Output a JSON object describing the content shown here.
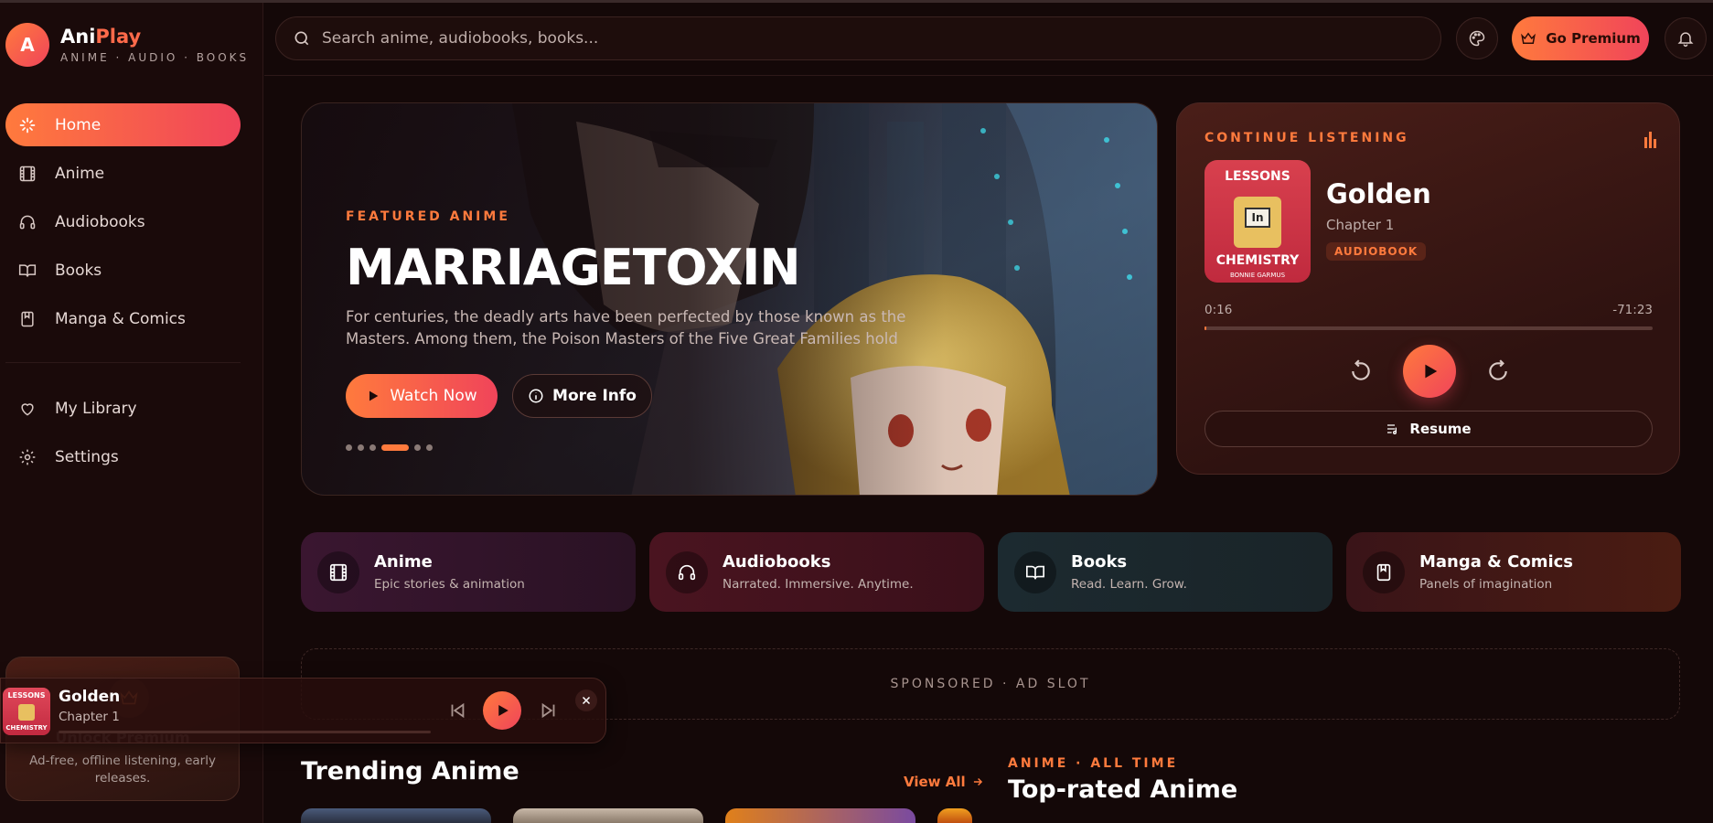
{
  "brand": {
    "logo_letter": "A",
    "name_part1": "Ani",
    "name_part2": "Play",
    "tagline": "ANIME · AUDIO · BOOKS"
  },
  "colors": {
    "accent": "#ff7a3d",
    "accent2": "#f0445a",
    "background": "#140808"
  },
  "nav": {
    "items": [
      {
        "label": "Home",
        "icon": "sparkle-icon",
        "active": true
      },
      {
        "label": "Anime",
        "icon": "film-icon"
      },
      {
        "label": "Audiobooks",
        "icon": "headphones-icon"
      },
      {
        "label": "Books",
        "icon": "open-book-icon"
      },
      {
        "label": "Manga & Comics",
        "icon": "bookmark-book-icon"
      }
    ],
    "secondary": [
      {
        "label": "My Library",
        "icon": "heart-icon"
      },
      {
        "label": "Settings",
        "icon": "gear-icon"
      }
    ]
  },
  "promo": {
    "title": "Unlock Premium",
    "text": "Ad-free, offline listening, early releases."
  },
  "header": {
    "search_placeholder": "Search anime, audiobooks, books...",
    "premium_label": "Go Premium"
  },
  "hero": {
    "eyebrow": "FEATURED ANIME",
    "title": "MARRIAGETOXIN",
    "description": "For centuries, the deadly arts have been perfected by those known as the Masters. Among them, the Poison Masters of the Five Great Families hold t...",
    "watch_label": "Watch Now",
    "info_label": "More Info",
    "slides": 6,
    "active_slide": 3
  },
  "continue": {
    "eyebrow": "CONTINUE LISTENING",
    "cover_line1": "LESSONS",
    "cover_line2": "In",
    "cover_line3": "CHEMISTRY",
    "cover_author": "BONNIE GARMUS",
    "title": "Golden",
    "chapter": "Chapter 1",
    "badge": "AUDIOBOOK",
    "elapsed": "0:16",
    "remaining": "-71:23",
    "progress": 0.004,
    "resume_label": "Resume"
  },
  "categories": [
    {
      "title": "Anime",
      "subtitle": "Epic stories & animation",
      "icon": "film-icon",
      "bg": "linear-gradient(90deg,#3a1630,#2a1224)"
    },
    {
      "title": "Audiobooks",
      "subtitle": "Narrated. Immersive. Anytime.",
      "icon": "headphones-icon",
      "bg": "linear-gradient(90deg,#4a1420,#3a101a)"
    },
    {
      "title": "Books",
      "subtitle": "Read. Learn. Grow.",
      "icon": "open-book-icon",
      "bg": "linear-gradient(90deg,#1c2a30,#1a2428)"
    },
    {
      "title": "Manga & Comics",
      "subtitle": "Panels of imagination",
      "icon": "bookmark-book-icon",
      "bg": "linear-gradient(90deg,#3a1418,#4a1c12)"
    }
  ],
  "ad": {
    "label": "SPONSORED · AD SLOT"
  },
  "trending": {
    "title": "Trending Anime",
    "view_all": "View All"
  },
  "toprated": {
    "eyebrow": "ANIME · ALL TIME",
    "title": "Top-rated Anime"
  },
  "mini_player": {
    "title": "Golden",
    "subtitle": "Chapter 1",
    "cover_top": "LESSONS",
    "cover_bottom": "CHEMISTRY"
  }
}
